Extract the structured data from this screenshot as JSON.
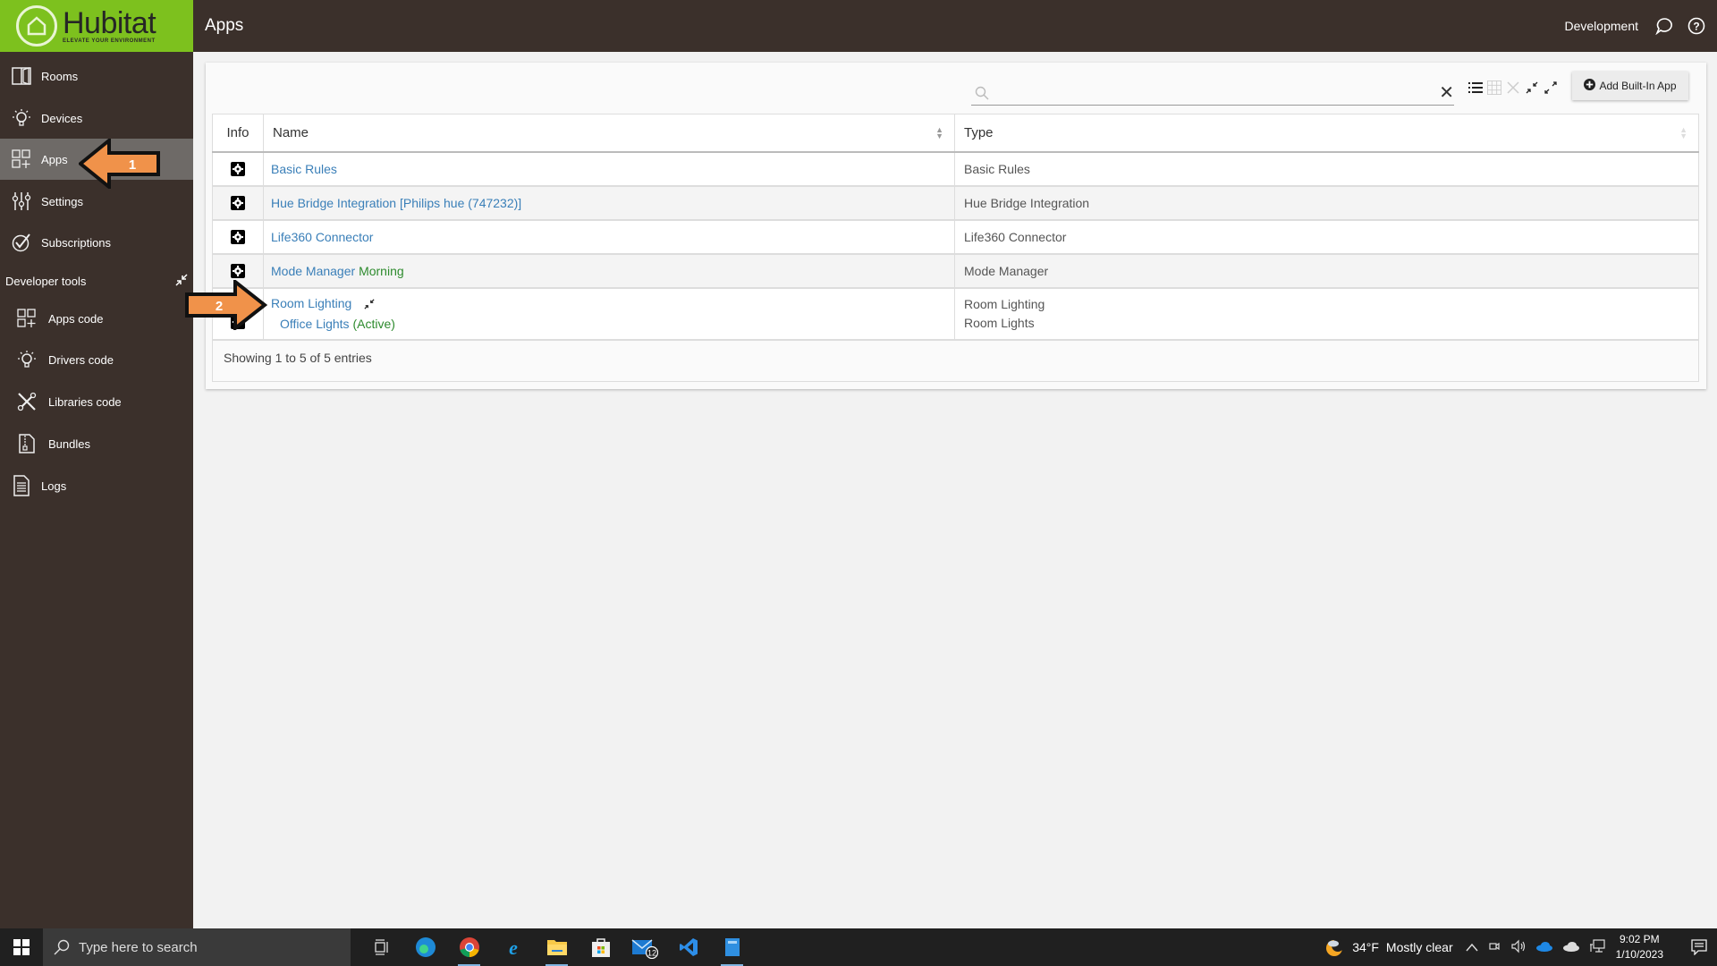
{
  "brand": {
    "name": "Hubitat",
    "tagline": "ELEVATE YOUR ENVIRONMENT",
    "color": "#7dc11e"
  },
  "header": {
    "title": "Apps",
    "hub_name": "Development",
    "chat_icon": "chat-bubble-icon",
    "help_icon": "help-circle-icon"
  },
  "sidebar": {
    "items": [
      {
        "label": "Rooms",
        "icon": "rooms-icon"
      },
      {
        "label": "Devices",
        "icon": "lightbulb-icon"
      },
      {
        "label": "Apps",
        "icon": "apps-grid-icon",
        "active": true
      },
      {
        "label": "Settings",
        "icon": "sliders-icon"
      },
      {
        "label": "Subscriptions",
        "icon": "check-circle-icon"
      }
    ],
    "section_label": "Developer tools",
    "dev_items": [
      {
        "label": "Apps code",
        "icon": "apps-grid-icon"
      },
      {
        "label": "Drivers code",
        "icon": "lightbulb-icon"
      },
      {
        "label": "Libraries code",
        "icon": "tools-icon"
      },
      {
        "label": "Bundles",
        "icon": "bundle-file-icon"
      },
      {
        "label": "Logs",
        "icon": "document-icon"
      }
    ]
  },
  "toolbar": {
    "search_placeholder": "",
    "search_value": "",
    "clear_label": "✕",
    "add_button_label": "Add Built-In App"
  },
  "table": {
    "columns": [
      "Info",
      "Name",
      "Type"
    ],
    "rows": [
      {
        "name": "Basic Rules",
        "status": "",
        "type": "Basic Rules"
      },
      {
        "name": "Hue Bridge Integration [Philips hue (747232)]",
        "status": "",
        "type": "Hue Bridge Integration"
      },
      {
        "name": "Life360 Connector",
        "status": "",
        "type": "Life360 Connector"
      },
      {
        "name": "Mode Manager",
        "status": "Morning",
        "type": "Mode Manager"
      },
      {
        "name": "Room Lighting",
        "status": "",
        "type": "Room Lighting",
        "child": {
          "name": "Office Lights",
          "status": "(Active)",
          "type": "Room Lights"
        }
      }
    ],
    "footer": "Showing 1 to 5 of 5 entries"
  },
  "annotations": [
    {
      "label": "1",
      "direction": "left",
      "color": "#f0924a"
    },
    {
      "label": "2",
      "direction": "right",
      "color": "#f0924a"
    }
  ],
  "taskbar": {
    "search_placeholder": "Type here to search",
    "apps": [
      "task-view",
      "edge",
      "chrome",
      "internet-explorer",
      "file-explorer",
      "store",
      "mail",
      "vscode",
      "app"
    ],
    "mail_badge": "12",
    "weather": {
      "temp": "34°F",
      "condition": "Mostly clear"
    },
    "time": "9:02 PM",
    "date": "1/10/2023"
  }
}
